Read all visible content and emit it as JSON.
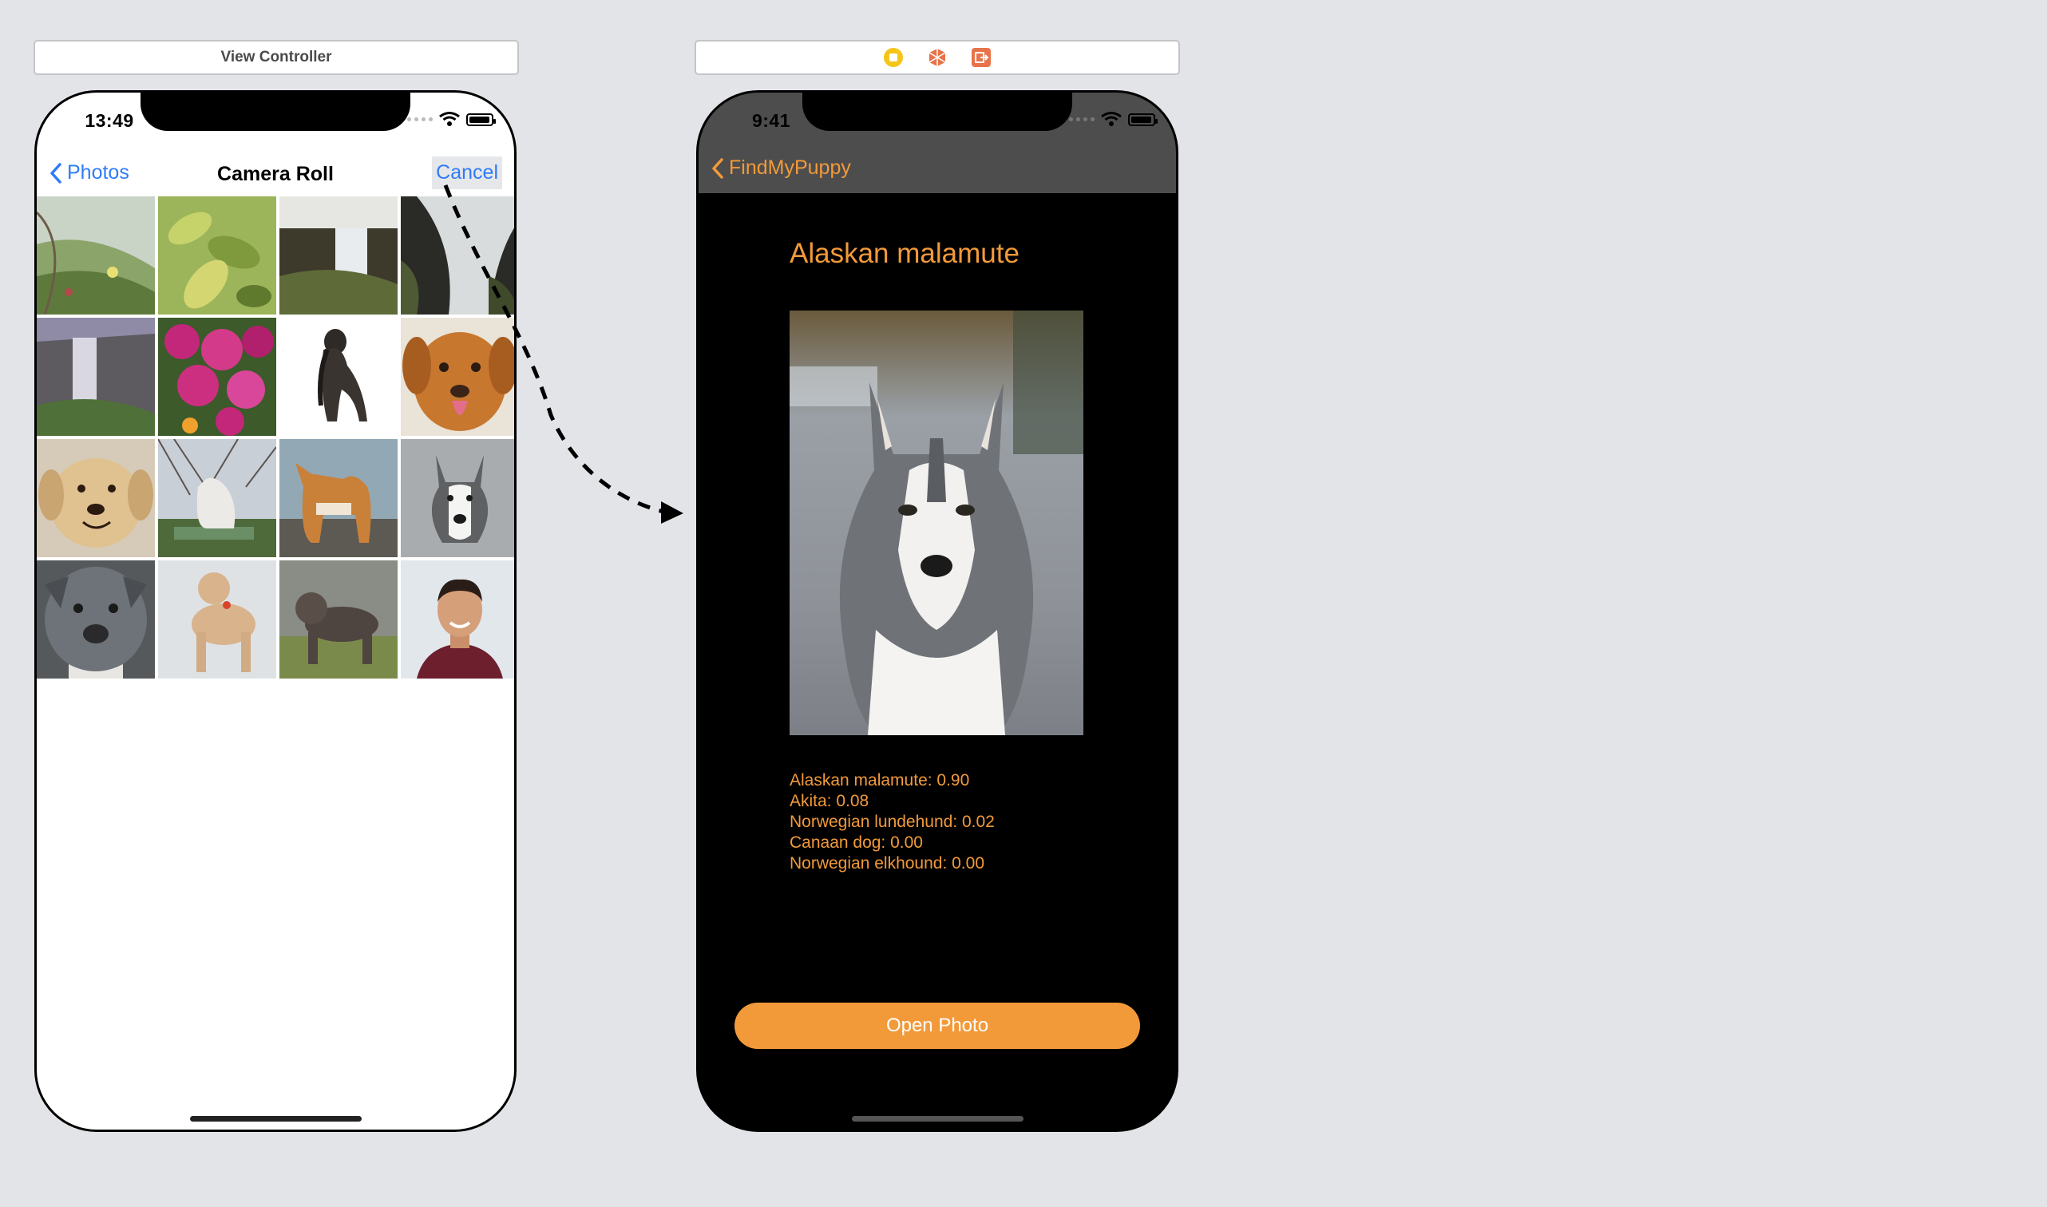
{
  "scenes": {
    "left_header": {
      "title": "View Controller"
    },
    "right_header": {
      "icons": [
        {
          "name": "view-controller-icon",
          "color": "#f5c518"
        },
        {
          "name": "first-responder-icon",
          "color": "#e8734a"
        },
        {
          "name": "exit-icon",
          "color": "#e8734a"
        }
      ]
    }
  },
  "picker_screen": {
    "status_time": "13:49",
    "nav": {
      "back_label": "Photos",
      "title": "Camera Roll",
      "cancel_label": "Cancel"
    },
    "photos": [
      "meadow-photo",
      "leaves-photo",
      "waterfall-cliff-photo",
      "waterfall-rocks-photo",
      "waterfall-valley-photo",
      "pink-flowers-photo",
      "afghan-hound-photo",
      "retriever-photo",
      "golden-retriever-photo",
      "white-dog-on-bench-photo",
      "shiba-inu-photo",
      "husky-photo",
      "pitbull-face-photo",
      "poodle-photo",
      "bulldog-grass-photo",
      "smiling-man-photo"
    ]
  },
  "result_screen": {
    "status_time": "9:41",
    "nav": {
      "back_label": "FindMyPuppy"
    },
    "breed": "Alaskan malamute",
    "predictions": [
      "Alaskan malamute: 0.90",
      "Akita: 0.08",
      "Norwegian lundehund: 0.02",
      "Canaan dog: 0.00",
      "Norwegian elkhound: 0.00"
    ],
    "button_label": "Open Photo",
    "accent_color": "#f29a3a",
    "nav_color": "#4d4d4d"
  }
}
